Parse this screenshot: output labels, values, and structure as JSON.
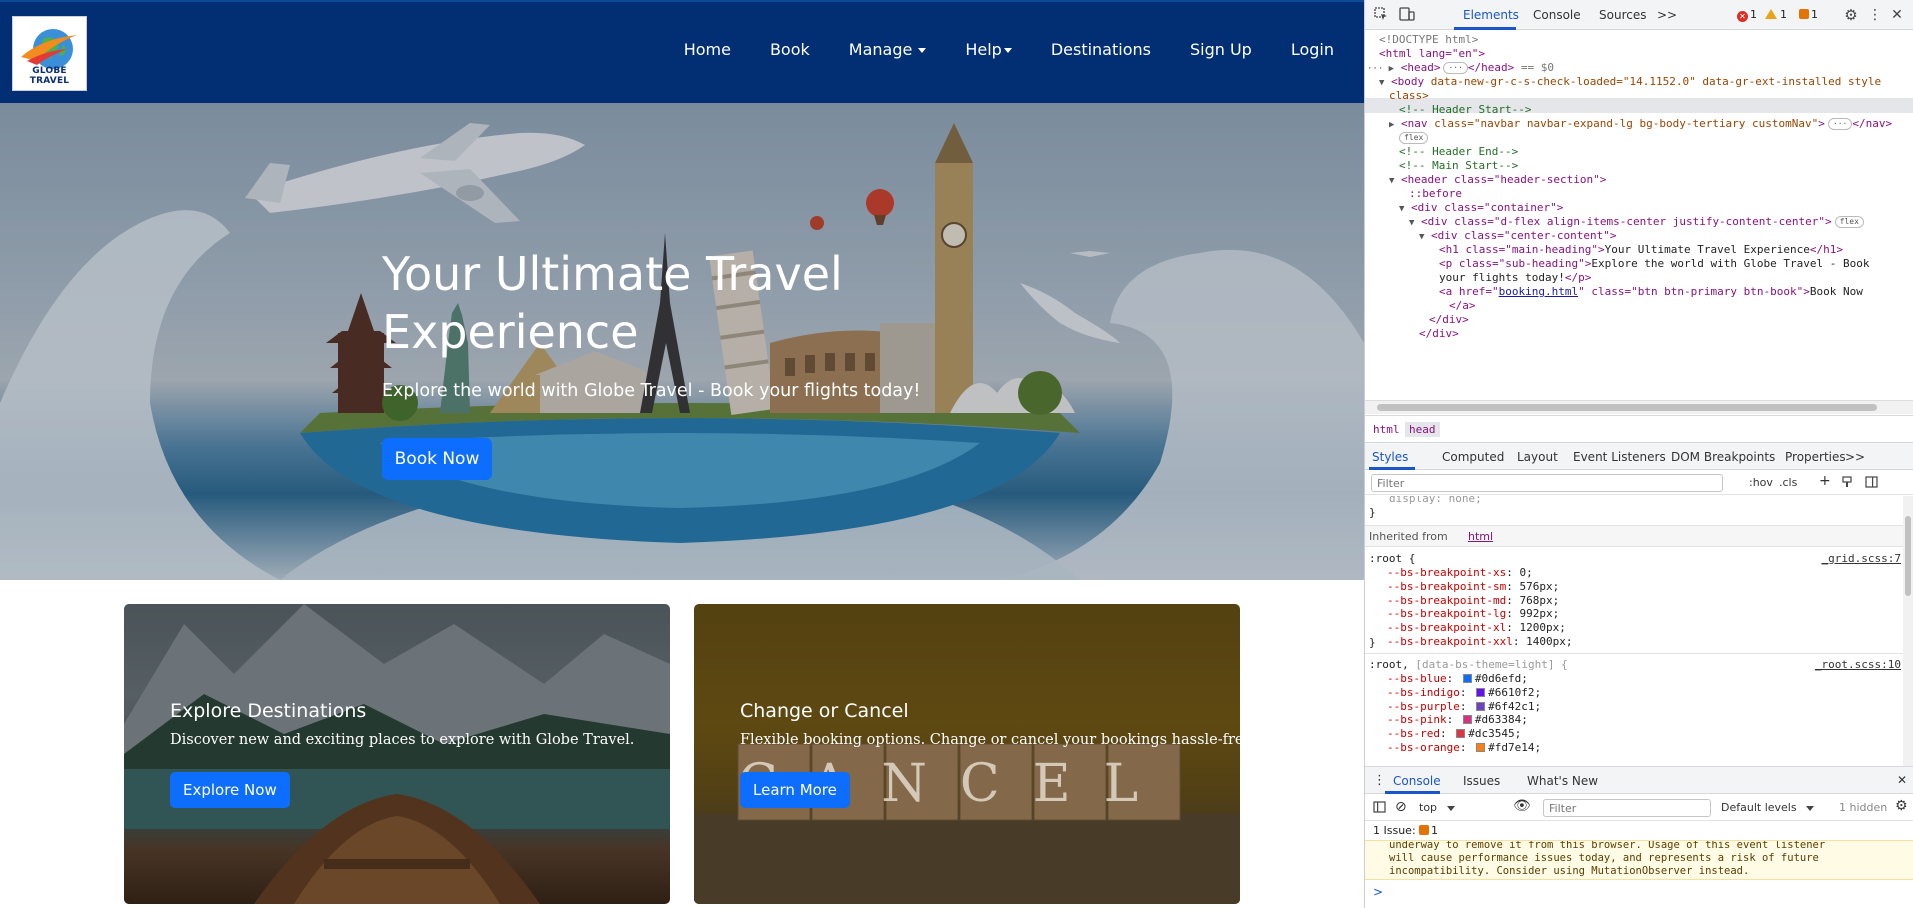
{
  "site": {
    "logo_text": "GLOBE TRAVEL",
    "nav": [
      {
        "label": "Home"
      },
      {
        "label": "Book"
      },
      {
        "label": "Manage"
      },
      {
        "label": "Help"
      },
      {
        "label": "Destinations"
      },
      {
        "label": "Sign Up"
      },
      {
        "label": "Login"
      }
    ],
    "hero": {
      "title": "Your Ultimate Travel Experience",
      "subtitle": "Explore the world with Globe Travel - Book your flights today!",
      "button": "Book Now"
    },
    "cards": [
      {
        "title": "Explore Destinations",
        "text": "Discover new and exciting places to explore with Globe Travel.",
        "button": "Explore Now"
      },
      {
        "title": "Change or Cancel",
        "text": "Flexible booking options. Change or cancel your bookings hassle-free.",
        "button": "Learn More",
        "image_word": "CANCEL"
      }
    ]
  },
  "devtools": {
    "tabs": [
      "Elements",
      "Console",
      "Sources"
    ],
    "more": ">>",
    "counts": {
      "errors": "1",
      "warnings": "1",
      "issues": "1"
    },
    "dom": {
      "doctype": "<!DOCTYPE html>",
      "html_open": "<html lang=\"en\">",
      "head": "<head>",
      "head_close": "</head>",
      "head_eq": "== $0",
      "body_tag": "<body",
      "body_attrs": " data-new-gr-c-s-check-loaded=\"14.1152.0\" data-gr-ext-installed style",
      "body_cont": "class>",
      "c1": "<!-- Header Start-->",
      "nav_open": "<nav",
      "nav_attr": " class=\"navbar navbar-expand-lg bg-body-tertiary customNav\"",
      "nav_end": "</nav>",
      "flex": "flex",
      "c2": "<!-- Header End-->",
      "c3": "<!-- Main Start-->",
      "header_open": "<header class=\"header-section\">",
      "before": "::before",
      "div_container": "<div class=\"container\">",
      "div_flex": "<div class=\"d-flex align-items-center justify-content-center\">",
      "div_center": "<div class=\"center-content\">",
      "h1_open": "<h1 class=\"main-heading\">",
      "h1_text": "Your Ultimate Travel Experience",
      "h1_close": "</h1>",
      "p_open": "<p class=\"sub-heading\">",
      "p_text1": "Explore the world with Globe Travel - Book",
      "p_text2": "your flights today!",
      "p_close": "</p>",
      "a_open": "<a href=\"",
      "a_href": "booking.html",
      "a_rest": "\" class=\"btn btn-primary btn-book\">",
      "a_text": "Book Now",
      "a_close": "</a>",
      "div_close": "</div>",
      "div_close2": "</div>"
    },
    "breadcrumbs": [
      "html",
      "head"
    ],
    "style_tabs": [
      "Styles",
      "Computed",
      "Layout",
      "Event Listeners",
      "DOM Breakpoints",
      "Properties"
    ],
    "styles_filter_placeholder": "Filter",
    "hov": ":hov",
    "cls": ".cls",
    "styles": {
      "prev_fragment": "display: none;",
      "brace": "}",
      "inherited_label": "Inherited from",
      "inherited_tag": "html",
      "root_selector": ":root {",
      "root_source": "_grid.scss:7",
      "breakpoints": [
        {
          "prop": "--bs-breakpoint-xs",
          "value": "0;"
        },
        {
          "prop": "--bs-breakpoint-sm",
          "value": "576px;"
        },
        {
          "prop": "--bs-breakpoint-md",
          "value": "768px;"
        },
        {
          "prop": "--bs-breakpoint-lg",
          "value": "992px;"
        },
        {
          "prop": "--bs-breakpoint-xl",
          "value": "1200px;"
        },
        {
          "prop": "--bs-breakpoint-xxl",
          "value": "1400px;"
        }
      ],
      "root2_selector": ":root,",
      "root2_extra": " [data-bs-theme=light] {",
      "root2_source": "_root.scss:10",
      "colors": [
        {
          "prop": "--bs-blue",
          "value": "#0d6efd;",
          "hex": "#0d6efd"
        },
        {
          "prop": "--bs-indigo",
          "value": "#6610f2;",
          "hex": "#6610f2"
        },
        {
          "prop": "--bs-purple",
          "value": "#6f42c1;",
          "hex": "#6f42c1"
        },
        {
          "prop": "--bs-pink",
          "value": "#d63384;",
          "hex": "#d63384"
        },
        {
          "prop": "--bs-red",
          "value": "#dc3545;",
          "hex": "#dc3545"
        },
        {
          "prop": "--bs-orange",
          "value": "#fd7e14;",
          "hex": "#fd7e14"
        }
      ]
    },
    "drawer_tabs": [
      "Console",
      "Issues",
      "What's New"
    ],
    "console": {
      "context": "top",
      "filter_placeholder": "Filter",
      "levels": "Default levels",
      "hidden": "1 hidden",
      "issues_label": "1 Issue:",
      "issues_count": "1",
      "warning_lines": [
        "underway to remove it from this browser. Usage of this event listener",
        "will cause performance issues today, and represents a risk of future",
        "incompatibility. Consider using MutationObserver instead."
      ],
      "prompt": ">"
    }
  }
}
